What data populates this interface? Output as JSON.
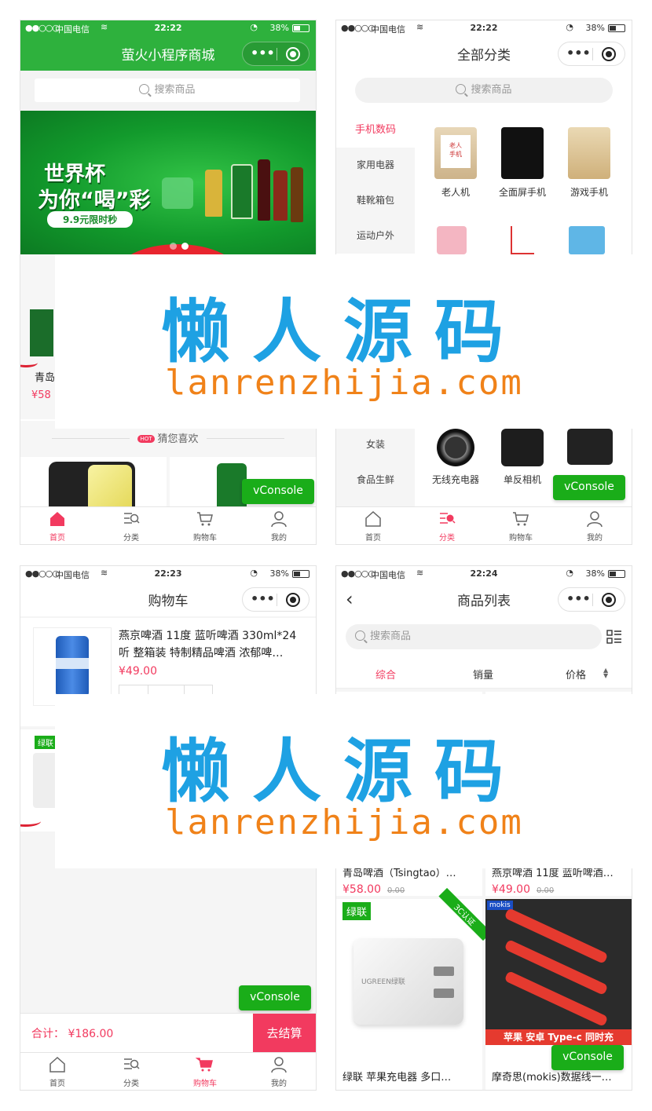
{
  "status": {
    "carrier": "中国电信",
    "battery": "38%",
    "time1": "22:22",
    "time2": "22:22",
    "time3": "22:23",
    "time4": "22:24"
  },
  "home": {
    "title": "萤火小程序商城",
    "search_placeholder": "搜索商品",
    "banner_line1": "世界杯",
    "banner_line2": "为你“喝”彩",
    "banner_promo": "9.9元限时秒",
    "product_partial": "青岛啤",
    "price_partial": "¥58",
    "guess_label": "猜您喜欢",
    "hot_badge": "HOT"
  },
  "category": {
    "title": "全部分类",
    "search_placeholder": "搜索商品",
    "side": [
      "手机数码",
      "家用电器",
      "鞋靴箱包",
      "运动户外"
    ],
    "side_lower": [
      "女装",
      "食品生鲜"
    ],
    "products_top": [
      "老人机",
      "全面屏手机",
      "游戏手机"
    ],
    "products_bottom": [
      "无线充电器",
      "单反相机"
    ],
    "phone_tag": "老人\n手机"
  },
  "cart": {
    "title": "购物车",
    "item_name": "燕京啤酒 11度 蓝听啤酒 330ml*24听 整箱装 特制精品啤酒 浓郁啤…",
    "item_price": "¥49.00",
    "badge": "绿联",
    "total": "合计：  ¥186.00",
    "checkout": "去结算"
  },
  "list": {
    "title": "商品列表",
    "search_placeholder": "搜索商品",
    "sort": [
      "综合",
      "销量",
      "价格"
    ],
    "card1_title": "青岛啤酒（Tsingtao）…",
    "card1_price": "¥58.00",
    "card1_old": "0.00",
    "card2_title": "燕京啤酒 11度 蓝听啤酒…",
    "card2_price": "¥49.00",
    "card2_old": "0.00",
    "card3_badge": "绿联",
    "card3_corner": "3C认证",
    "card3_brand": "UGREEN绿联",
    "card3_title": "绿联 苹果充电器 多口…",
    "card4_badge": "mokis",
    "card4_banner": "苹果 安卓 Type-c 同时充",
    "card4_title": "摩奇思(mokis)数据线一…"
  },
  "tabs": [
    "首页",
    "分类",
    "购物车",
    "我的"
  ],
  "vconsole": "vConsole",
  "watermark": {
    "big": "懒人源码",
    "small": "lanrenzhijia.com"
  },
  "colors": {
    "wechat_green": "#1aad19",
    "accent_pink": "#f23a5f",
    "watermark_blue": "#1ea1e3",
    "watermark_orange": "#f08219"
  }
}
